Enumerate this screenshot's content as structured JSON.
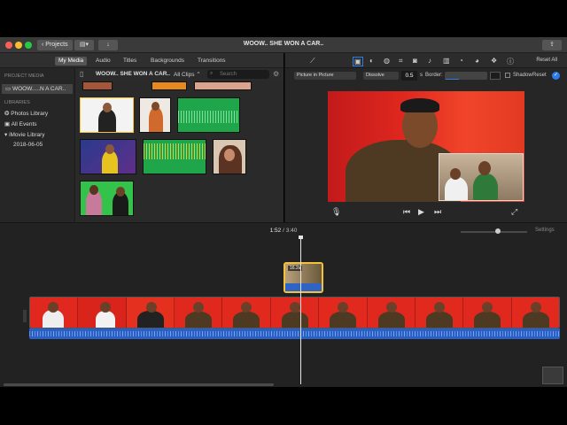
{
  "titlebar": {
    "projects_label": "Projects",
    "title": "WOOW.. SHE WON A CAR.."
  },
  "tabs": [
    "My Media",
    "Audio",
    "Titles",
    "Backgrounds",
    "Transitions"
  ],
  "sidebar": {
    "project_media_header": "PROJECT MEDIA",
    "project_item": "WOOW.....N A CAR..",
    "libraries_header": "LIBRARIES",
    "items": [
      "Photos Library",
      "All Events",
      "iMovie Library",
      "2018-06-05"
    ]
  },
  "browser": {
    "event_title": "WOOW.. SHE WON A CAR..",
    "filter": "All Clips",
    "search_placeholder": "Search"
  },
  "viewer_controls": {
    "reset_all": "Reset All",
    "overlay_style": "Picture in Picture",
    "transition": "Dissolve",
    "duration": "0.5",
    "border_label": "Border:",
    "shadow_label": "Shadow",
    "reset_label": "Reset"
  },
  "timeline": {
    "current_time": "1:52",
    "separator": "/",
    "total_time": "3:40",
    "settings_label": "Settings",
    "overlay_clip_duration": "16.2s"
  },
  "colors": {
    "accent": "#2b7de9",
    "selection": "#f2c23a",
    "audio": "#2a5fc4",
    "red_bg": "#e0281f"
  }
}
